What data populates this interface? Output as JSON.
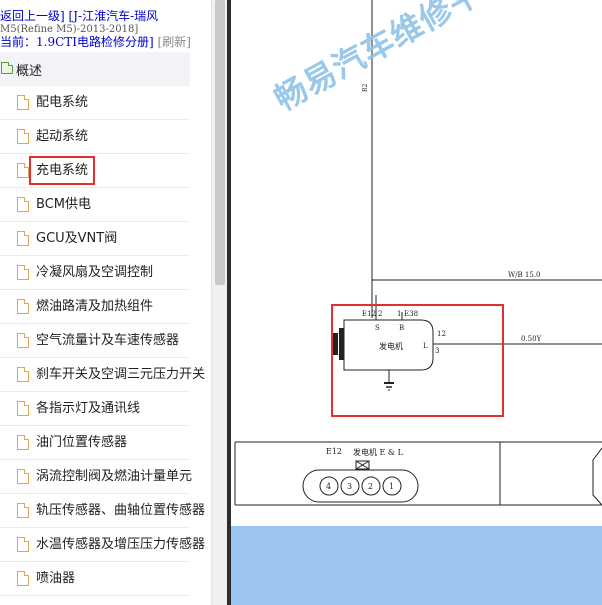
{
  "breadcrumb": {
    "back_link": "返回上一级]",
    "model_link": "[J-江淮汽车-瑞风",
    "model_sub": "M5(Refine M5)-2013-2018]",
    "current_label": "当前：",
    "current_value": "1.9CTI电路检修分册]",
    "refresh": "[刷新]"
  },
  "tree": {
    "root_label": "概述",
    "items": [
      "配电系统",
      "起动系统",
      "充电系统",
      "BCM供电",
      "GCU及VNT阀",
      "冷凝风扇及空调控制",
      "燃油路清及加热组件",
      "空气流量计及车速传感器",
      "刹车开关及空调三元压力开关",
      "各指示灯及通讯线",
      "油门位置传感器",
      "涡流控制阀及燃油计量单元",
      "轨压传感器、曲轴位置传感器",
      "水温传感器及增压压力传感器",
      "喷油器"
    ],
    "selected_index": 2
  },
  "diagram": {
    "watermark": "畅易汽车维修平台",
    "wire_top": "R2",
    "wire_wb": "W/B 15.0",
    "wire_05": "0.50Y",
    "pin_e12": "E12",
    "pin_2": "2",
    "pin_1": "1",
    "pin_e38": "E38",
    "pin_s": "S",
    "pin_b": "B",
    "pin_12": "12",
    "pin_l": "L",
    "pin_3": "3",
    "generator": "发电机",
    "conn_id": "E12",
    "conn_title": "发电机 E & L",
    "conn_pins": [
      "4",
      "3",
      "2",
      "1"
    ]
  },
  "colors": {
    "highlight_red": "#e23030",
    "link_blue": "#0000cc",
    "watermark": "#8fc3e6",
    "bottom_panel": "#9bc4ef"
  }
}
